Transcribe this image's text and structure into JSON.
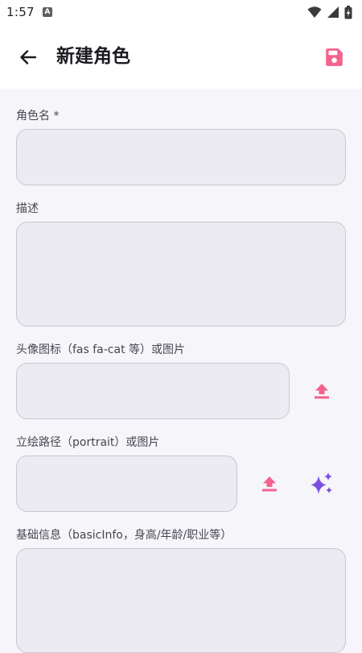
{
  "status_bar": {
    "time": "1:57",
    "app_icon_letter": "A"
  },
  "header": {
    "title": "新建角色",
    "back_icon": "arrow-left-icon",
    "save_icon": "save-icon"
  },
  "colors": {
    "accent_pink": "#f4628e",
    "accent_purple": "#7b4fe0",
    "field_bg": "#ebebf1",
    "page_bg": "#f6f5fa"
  },
  "form": {
    "name_label": "角色名 *",
    "name_value": "",
    "description_label": "描述",
    "description_value": "",
    "avatar_label": "头像图标（fas fa-cat 等）或图片",
    "avatar_value": "",
    "portrait_label": "立绘路径（portrait）或图片",
    "portrait_value": "",
    "basic_info_label": "基础信息（basicInfo，身高/年龄/职业等）",
    "basic_info_value": ""
  }
}
